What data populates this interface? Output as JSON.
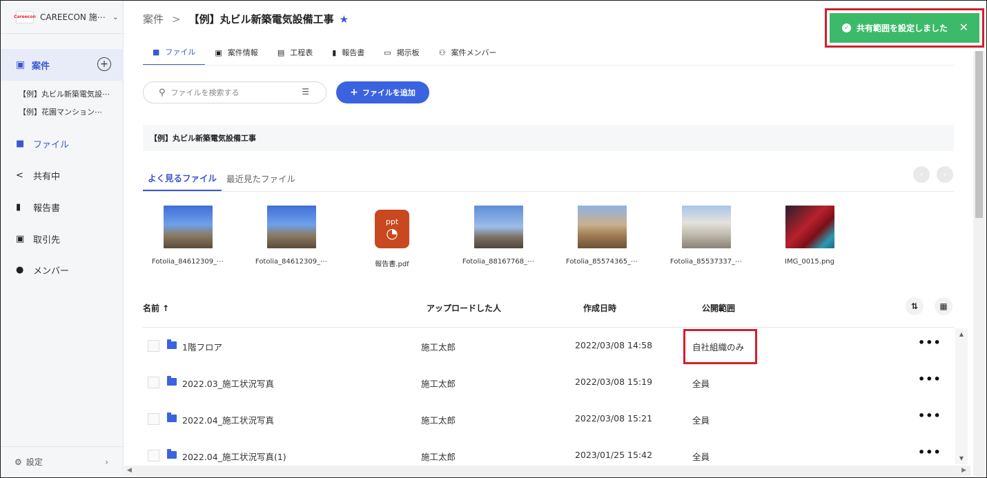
{
  "sidebar": {
    "org_logo": "Careecon",
    "org_name": "CAREECON 施⋯",
    "active_label": "案件",
    "projects": [
      "【例】丸ビル新築電気設⋯",
      "【例】花園マンション⋯"
    ],
    "nav": [
      {
        "label": "ファイル",
        "icon": "folder-icon"
      },
      {
        "label": "共有中",
        "icon": "share-icon"
      },
      {
        "label": "報告書",
        "icon": "book-icon"
      },
      {
        "label": "取引先",
        "icon": "contact-icon"
      },
      {
        "label": "メンバー",
        "icon": "person-icon"
      }
    ],
    "settings_label": "設定"
  },
  "header": {
    "breadcrumb_root": "案件",
    "breadcrumb_current": "【例】丸ビル新築電気設備工事"
  },
  "tabs": [
    "ファイル",
    "案件情報",
    "工程表",
    "報告書",
    "掲示板",
    "案件メンバー"
  ],
  "search": {
    "placeholder": "ファイルを検索する"
  },
  "add_button": "ファイルを追加",
  "folder_bar": "【例】丸ビル新築電気設備工事",
  "file_tabs": [
    "よく見るファイル",
    "最近見たファイル"
  ],
  "thumbnails": [
    "Fotolia_84612309_⋯",
    "Fotolia_84612309_⋯",
    "報告書.pdf",
    "Fotolia_88167768_⋯",
    "Fotolia_85574365_⋯",
    "Fotolia_85537337_⋯",
    "IMG_0015.png"
  ],
  "ppt_label": "ppt",
  "table": {
    "headers": {
      "name": "名前 ↑",
      "uploader": "アップロードした人",
      "created": "作成日時",
      "scope": "公開範囲"
    },
    "rows": [
      {
        "name": "1階フロア",
        "uploader": "施工太郎",
        "created": "2022/03/08 14:58",
        "scope": "自社組織のみ"
      },
      {
        "name": "2022.03_施工状況写真",
        "uploader": "施工太郎",
        "created": "2022/03/08 15:19",
        "scope": "全員"
      },
      {
        "name": "2022.04_施工状況写真",
        "uploader": "施工太郎",
        "created": "2022/03/08 15:21",
        "scope": "全員"
      },
      {
        "name": "2022.04_施工状況写真(1)",
        "uploader": "施工太郎",
        "created": "2023/01/25 15:42",
        "scope": "全員"
      }
    ]
  },
  "toast": {
    "message": "共有範囲を設定しました"
  },
  "colors": {
    "accent": "#3b57d1",
    "toast_bg": "#3cba6a",
    "highlight": "#d21f2a"
  }
}
